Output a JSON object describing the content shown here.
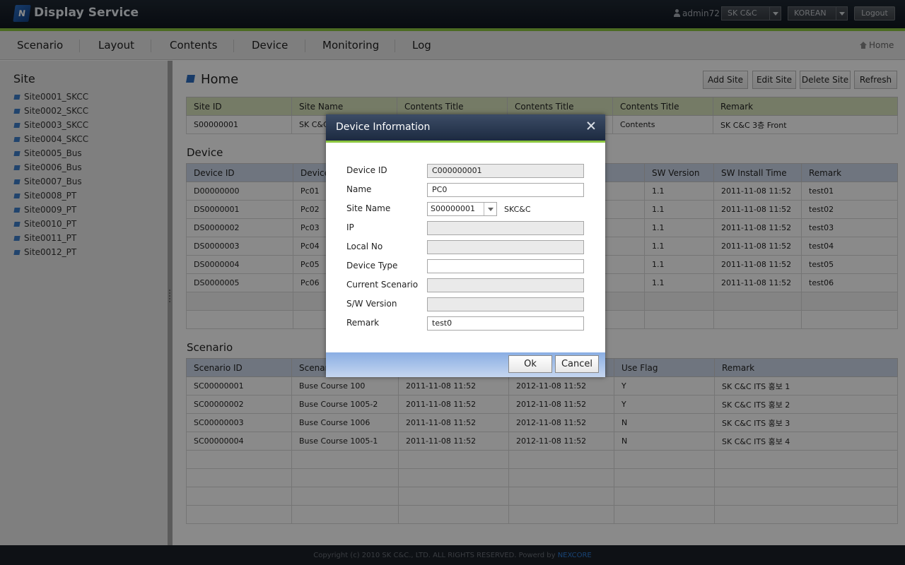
{
  "header": {
    "logo_letter": "N",
    "app_title": "Display Service",
    "user": "admin72",
    "company": "SK C&C",
    "language": "KOREAN",
    "logout_label": "Logout"
  },
  "nav": {
    "items": [
      "Scenario",
      "Layout",
      "Contents",
      "Device",
      "Monitoring",
      "Log"
    ],
    "home_link": "Home"
  },
  "sidebar": {
    "title": "Site",
    "items": [
      "Site0001_SKCC",
      "Site0002_SKCC",
      "Site0003_SKCC",
      "Site0004_SKCC",
      "Site0005_Bus",
      "Site0006_Bus",
      "Site0007_Bus",
      "Site0008_PT",
      "Site0009_PT",
      "Site0010_PT",
      "Site0011_PT",
      "Site0012_PT"
    ]
  },
  "main": {
    "title": "Home",
    "buttons": {
      "add_site": "Add Site",
      "edit_site": "Edit Site",
      "delete_site": "Delete Site",
      "refresh": "Refresh"
    },
    "site_table": {
      "headers": [
        "Site ID",
        "Site Name",
        "Contents Title",
        "Contents Title",
        "Contents Title",
        "Remark"
      ],
      "rows": [
        [
          "S00000001",
          "SK C&C",
          "",
          "",
          "Contents",
          "SK C&C 3층 Front"
        ]
      ]
    },
    "device_section_title": "Device",
    "device_table": {
      "headers": [
        "Device ID",
        "Device",
        "",
        "",
        "SW Version",
        "SW Install Time",
        "Remark"
      ],
      "rows": [
        [
          "D00000000",
          "Pc01",
          "",
          "",
          "1.1",
          "2011-11-08 11:52",
          "test01"
        ],
        [
          "DS0000001",
          "Pc02",
          "",
          "",
          "1.1",
          "2011-11-08 11:52",
          "test02"
        ],
        [
          "DS0000002",
          "Pc03",
          "",
          "",
          "1.1",
          "2011-11-08 11:52",
          "test03"
        ],
        [
          "DS0000003",
          "Pc04",
          "",
          "",
          "1.1",
          "2011-11-08 11:52",
          "test04"
        ],
        [
          "DS0000004",
          "Pc05",
          "",
          "",
          "1.1",
          "2011-11-08 11:52",
          "test05"
        ],
        [
          "DS0000005",
          "Pc06",
          "",
          "",
          "1.1",
          "2011-11-08 11:52",
          "test06"
        ]
      ]
    },
    "scenario_section_title": "Scenario",
    "scenario_table": {
      "headers": [
        "Scenario ID",
        "Scenar",
        "",
        "",
        "Use Flag",
        "Remark"
      ],
      "rows": [
        [
          "SC00000001",
          "Buse Course 100",
          "2011-11-08 11:52",
          "2012-11-08 11:52",
          "Y",
          "SK C&C ITS 홍보 1"
        ],
        [
          "SC00000002",
          "Buse Course 1005-2",
          "2011-11-08 11:52",
          "2012-11-08 11:52",
          "Y",
          "SK C&C ITS 홍보 2"
        ],
        [
          "SC00000003",
          "Buse Course 1006",
          "2011-11-08 11:52",
          "2012-11-08 11:52",
          "N",
          "SK C&C ITS 홍보 3"
        ],
        [
          "SC00000004",
          "Buse Course 1005-1",
          "2011-11-08 11:52",
          "2012-11-08 11:52",
          "N",
          "SK C&C ITS 홍보 4"
        ]
      ]
    }
  },
  "dialog": {
    "title": "Device Information",
    "fields": {
      "device_id": {
        "label": "Device ID",
        "value": "C000000001"
      },
      "name": {
        "label": "Name",
        "value": "PC0"
      },
      "site_name": {
        "label": "Site Name",
        "value": "S00000001",
        "text": "SKC&C"
      },
      "ip": {
        "label": "IP",
        "value": ""
      },
      "local_no": {
        "label": "Local No",
        "value": ""
      },
      "device_type": {
        "label": "Device Type",
        "value": ""
      },
      "current_scenario": {
        "label": "Current Scenario",
        "value": ""
      },
      "sw_version": {
        "label": "S/W Version",
        "value": ""
      },
      "remark": {
        "label": "Remark",
        "value": "test0"
      }
    },
    "ok_label": "Ok",
    "cancel_label": "Cancel"
  },
  "footer": {
    "copyright": "Copyright (c) 2010 SK C&C., LTD. ALL RIGHTS RESERVED. Powerd by",
    "brand": "NEXCORE"
  }
}
